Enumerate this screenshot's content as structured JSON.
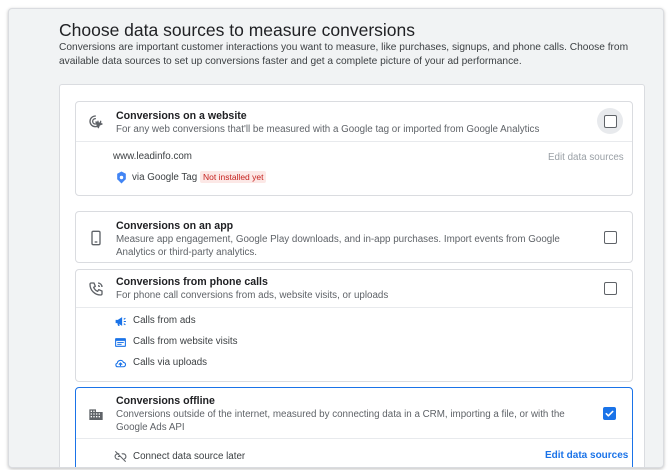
{
  "header": {
    "title": "Choose data sources to measure conversions",
    "description": "Conversions are important customer interactions you want to measure, like purchases, signups, and phone calls. Choose from available data sources to set up conversions faster and get a complete picture of your ad performance."
  },
  "cards": {
    "website": {
      "icon": "cursor-click-icon",
      "title": "Conversions on a website",
      "description": "For any web conversions that'll be measured with a Google tag or imported from Google Analytics",
      "checked": false,
      "domain": "www.leadinfo.com",
      "edit_link": "Edit data sources",
      "tag_label": "via Google Tag",
      "tag_status": "Not installed yet",
      "tag_status_color": "#c5221f"
    },
    "app": {
      "icon": "smartphone-icon",
      "title": "Conversions on an app",
      "description": "Measure app engagement, Google Play downloads, and in-app purchases. Import events from Google Analytics or third-party analytics.",
      "checked": false
    },
    "phone": {
      "icon": "phone-icon",
      "title": "Conversions from phone calls",
      "description": "For phone call conversions from ads, website visits, or uploads",
      "checked": false,
      "items": [
        {
          "icon": "megaphone-icon",
          "label": "Calls from ads"
        },
        {
          "icon": "website-icon",
          "label": "Calls from website visits"
        },
        {
          "icon": "cloud-upload-icon",
          "label": "Calls via uploads"
        }
      ]
    },
    "offline": {
      "icon": "building-icon",
      "title": "Conversions offline",
      "description": "Conversions outside of the internet, measured by connecting data in a CRM, importing a file, or with the Google Ads API",
      "checked": true,
      "later_label": "Connect data source later",
      "edit_link": "Edit data sources"
    }
  },
  "colors": {
    "accent": "#1a73e8",
    "background": "#f1f3f4",
    "error": "#c5221f"
  }
}
